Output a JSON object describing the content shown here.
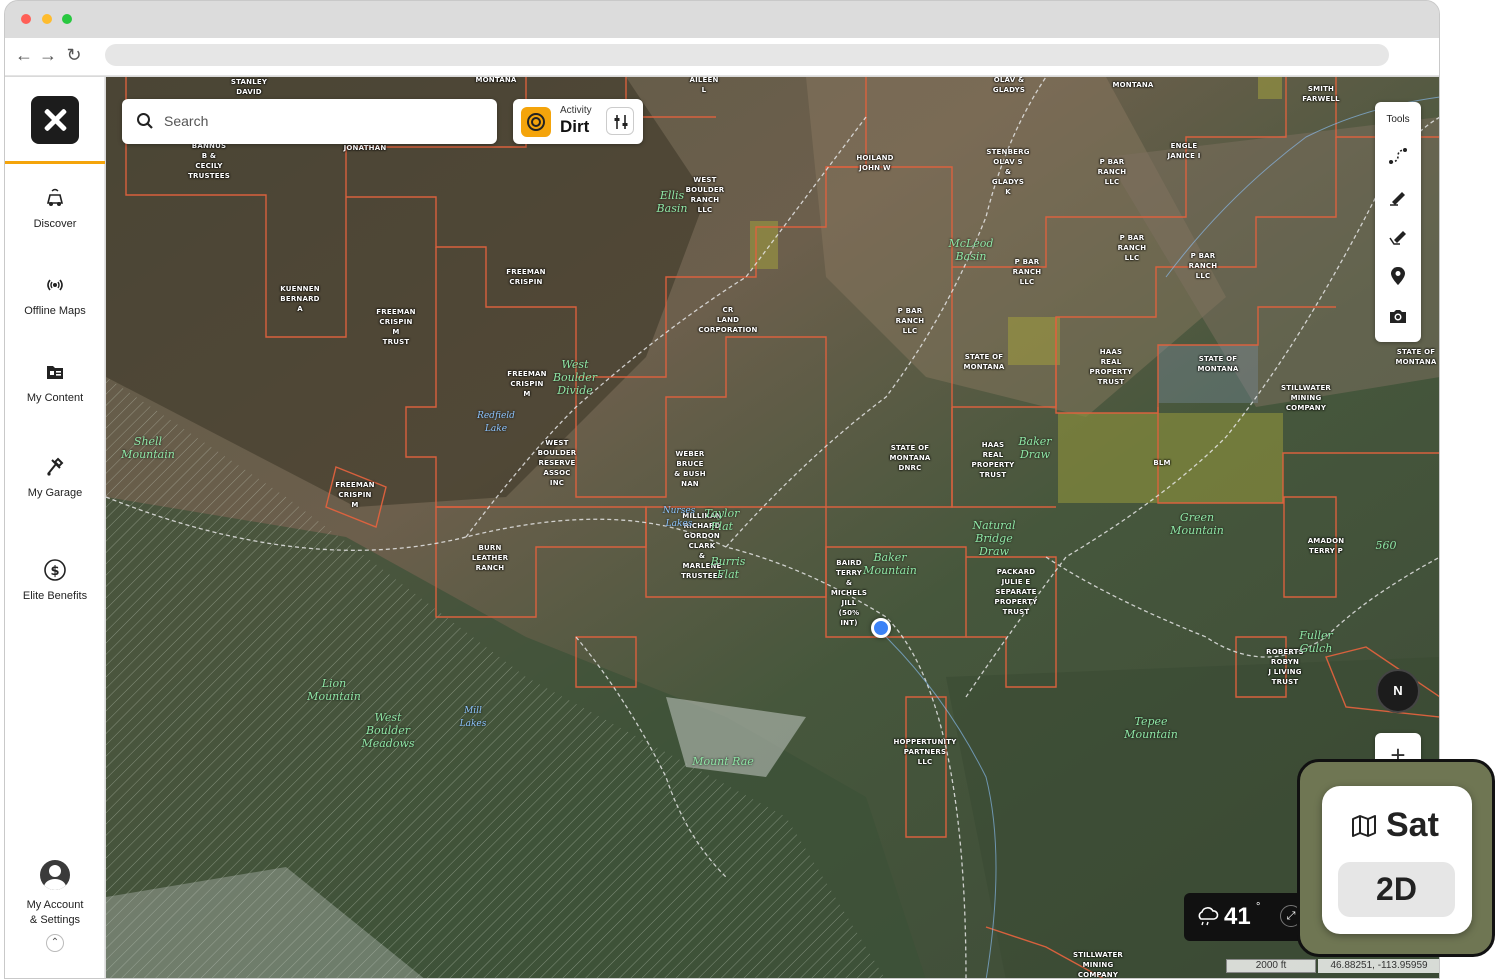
{
  "sidebar": {
    "items": [
      {
        "label": "Discover",
        "icon": "discover-icon"
      },
      {
        "label": "Offline Maps",
        "icon": "offline-maps-icon"
      },
      {
        "label": "My Content",
        "icon": "my-content-icon"
      },
      {
        "label": "My Garage",
        "icon": "my-garage-icon"
      },
      {
        "label": "Elite Benefits",
        "icon": "elite-benefits-icon"
      }
    ],
    "account_line1": "My Account",
    "account_line2": "& Settings"
  },
  "search": {
    "placeholder": "Search"
  },
  "activity": {
    "label": "Activity",
    "value": "Dirt"
  },
  "tools": {
    "title": "Tools",
    "items": [
      "route-icon",
      "draw-line-icon",
      "draw-shape-icon",
      "waypoint-icon",
      "camera-icon"
    ]
  },
  "compass": {
    "label": "N"
  },
  "weather": {
    "temp": "41",
    "unit": "°"
  },
  "scale": "2000 ft",
  "coords": "46.88251, -113.95959",
  "map_type": {
    "style": "Sat",
    "mode": "2D"
  },
  "colors": {
    "accent": "#f4a40b",
    "boundary": "#e0623e",
    "location": "#3b82f6"
  },
  "map_labels": {
    "l1": "STANLEY\nDAVID",
    "l2": "MONTANA",
    "l3": "AILEEN\nL",
    "l4": "OLAV &\nGLADYS",
    "l5": "MONTANA",
    "l6": "SMITH\nFARWELL",
    "l7": "BANNUS\nB &\nCECILY\nTRUSTEES",
    "l8": "JONATHAN",
    "l9": "HOILAND\nJOHN W",
    "l10": "STENBERG\nOLAV S\n&\nGLADYS\nK",
    "l11": "P BAR\nRANCH\nLLC",
    "l12": "ENGLE\nJANICE I",
    "l13": "WEST\nBOULDER\nRANCH\nLLC",
    "l14": "P BAR\nRANCH\nLLC",
    "l15": "P BAR\nRANCH\nLLC",
    "l16": "P BAR\nRANCH\nLLC",
    "l17": "FREEMAN\nCRISPIN",
    "l18": "KUENNEN\nBERNARD\nA",
    "l19": "FREEMAN\nCRISPIN\nM\nTRUST",
    "l20": "CR\nLAND\nCORPORATION",
    "l21": "P BAR\nRANCH\nLLC",
    "l22": "STATE OF\nMONTANA",
    "l23": "HAAS\nREAL\nPROPERTY\nTRUST",
    "l24": "STATE OF\nMONTANA",
    "l25": "STATE OF\nMONTANA",
    "l26": "STILLWATER\nMINING\nCOMPANY",
    "l27": "FREEMAN\nCRISPIN\nM",
    "l28": "WEST\nBOULDER\nRESERVE\nASSOC\nINC",
    "l29": "WEBER\nBRUCE\n& BUSH\nNAN",
    "l30": "STATE OF\nMONTANA\nDNRC",
    "l31": "HAAS\nREAL\nPROPERTY\nTRUST",
    "l32": "BLM",
    "l33": "FREEMAN\nCRISPIN\nM",
    "l34": "BURN\nLEATHER\nRANCH",
    "l35": "MILLIKAN\nRICHARD\nGORDON\nCLARK\n&\nMARLENE\nTRUSTEES",
    "l36": "BAIRD\nTERRY\n&\nMICHELS\nJILL\n(50%\nINT)",
    "l37": "PACKARD\nJULIE E\nSEPARATE\nPROPERTY\nTRUST",
    "l38": "AMADON\nTERRY P",
    "l39": "ROBERTS\nROBYN\nJ LIVING\nTRUST",
    "l40": "HOPPERTUNITY\nPARTNERS\nLLC",
    "l41": "STILLWATER\nMINING\nCOMPANY"
  },
  "geo_labels": {
    "g1": "Ellis\nBasin",
    "g2": "McLeod\nBasin",
    "g3": "West\nBoulder\nDivide",
    "g4": "Redfield\nLake",
    "g5": "Shell\nMountain",
    "g6": "Baker\nMountain",
    "g7": "Taylor\nFlat",
    "g8": "Nurses\nLakes",
    "g9": "Green\nMountain",
    "g10": "Natural\nBridge\nDraw",
    "g11": "Lion\nMountain",
    "g12": "West\nBoulder\nMeadows",
    "g13": "Mount Rae",
    "g14": "Tepee\nMountain",
    "g15": "Baker\nDraw",
    "g16": "Burris\nFlat",
    "g17": "Mill\nLakes",
    "g18": "Fuller\nGulch",
    "g19": "560"
  }
}
